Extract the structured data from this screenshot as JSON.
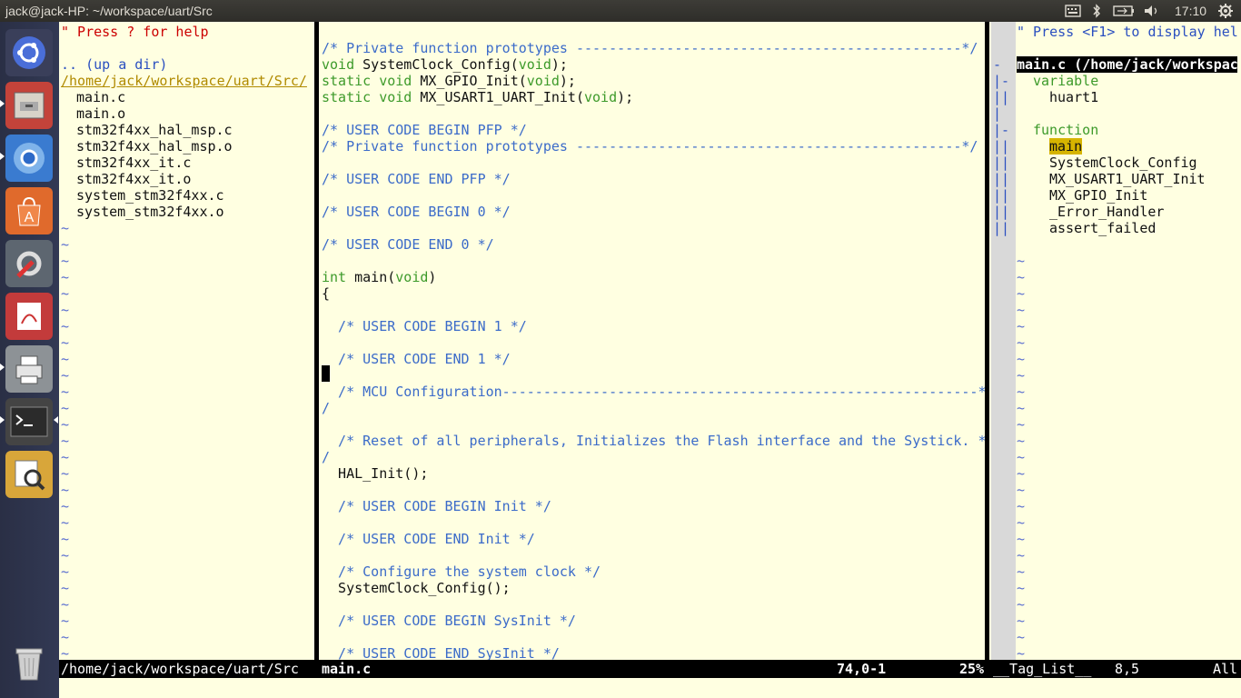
{
  "window": {
    "title": "jack@jack-HP: ~/workspace/uart/Src",
    "clock": "17:10"
  },
  "tray_icons": [
    "keyboard-icon",
    "bluetooth-icon",
    "battery-icon",
    "volume-icon",
    "gear-icon"
  ],
  "launcher": [
    {
      "name": "ubuntu-dash-icon"
    },
    {
      "name": "files-icon"
    },
    {
      "name": "chromium-icon"
    },
    {
      "name": "software-center-icon"
    },
    {
      "name": "system-settings-icon"
    },
    {
      "name": "pdf-viewer-icon"
    },
    {
      "name": "printer-icon"
    },
    {
      "name": "terminal-icon"
    },
    {
      "name": "image-viewer-icon"
    },
    {
      "name": "trash-icon"
    }
  ],
  "left_pane": {
    "help": "\" Press ? for help",
    "updir": ".. (up a dir)",
    "path": "/home/jack/workspace/uart/Src/",
    "files": [
      "main.c",
      "main.o",
      "stm32f4xx_hal_msp.c",
      "stm32f4xx_hal_msp.o",
      "stm32f4xx_it.c",
      "stm32f4xx_it.o",
      "system_stm32f4xx.c",
      "system_stm32f4xx.o"
    ]
  },
  "code": {
    "l1": "/* Private function prototypes -----------------------------------------------*/",
    "l2a": "void",
    "l2b": " SystemClock_Config(",
    "l2c": "void",
    "l2d": ");",
    "l3a": "static void",
    "l3b": " MX_GPIO_Init(",
    "l3c": "void",
    "l3d": ");",
    "l4a": "static void",
    "l4b": " MX_USART1_UART_Init(",
    "l4c": "void",
    "l4d": ");",
    "l6": "/* USER CODE BEGIN PFP */",
    "l7": "/* Private function prototypes -----------------------------------------------*/",
    "l9": "/* USER CODE END PFP */",
    "l11": "/* USER CODE BEGIN 0 */",
    "l13": "/* USER CODE END 0 */",
    "l15a": "int",
    "l15b": " main(",
    "l15c": "void",
    "l15d": ")",
    "l16": "{",
    "l18": "  /* USER CODE BEGIN 1 */",
    "l20": "  /* USER CODE END 1 */",
    "l22": "  /* MCU Configuration----------------------------------------------------------*",
    "l23": "/",
    "l25": "  /* Reset of all peripherals, Initializes the Flash interface and the Systick. *",
    "l26": "/",
    "l27": "  HAL_Init();",
    "l29": "  /* USER CODE BEGIN Init */",
    "l31": "  /* USER CODE END Init */",
    "l33": "  /* Configure the system clock */",
    "l34": "  SystemClock_Config();",
    "l36": "  /* USER CODE BEGIN SysInit */",
    "l38": "  /* USER CODE END SysInit */"
  },
  "fold_column": [
    "-",
    "|-",
    "||",
    "|",
    "|-",
    "||",
    "||",
    "||",
    "||",
    "||",
    "||"
  ],
  "taglist": {
    "help": "\" Press <F1> to display hel",
    "file": "main.c (/home/jack/workspac",
    "variable_label": "variable",
    "variables": [
      "huart1"
    ],
    "function_label": "function",
    "functions": [
      "main",
      "SystemClock_Config",
      "MX_USART1_UART_Init",
      "MX_GPIO_Init",
      "_Error_Handler",
      "assert_failed"
    ]
  },
  "status": {
    "left_path": "/home/jack/workspace/uart/Src",
    "file": "main.c",
    "position": "74,0-1",
    "percent": "25%",
    "taglist_name": "__Tag_List__",
    "taglist_pos": "8,5",
    "taglist_scroll": "All"
  }
}
